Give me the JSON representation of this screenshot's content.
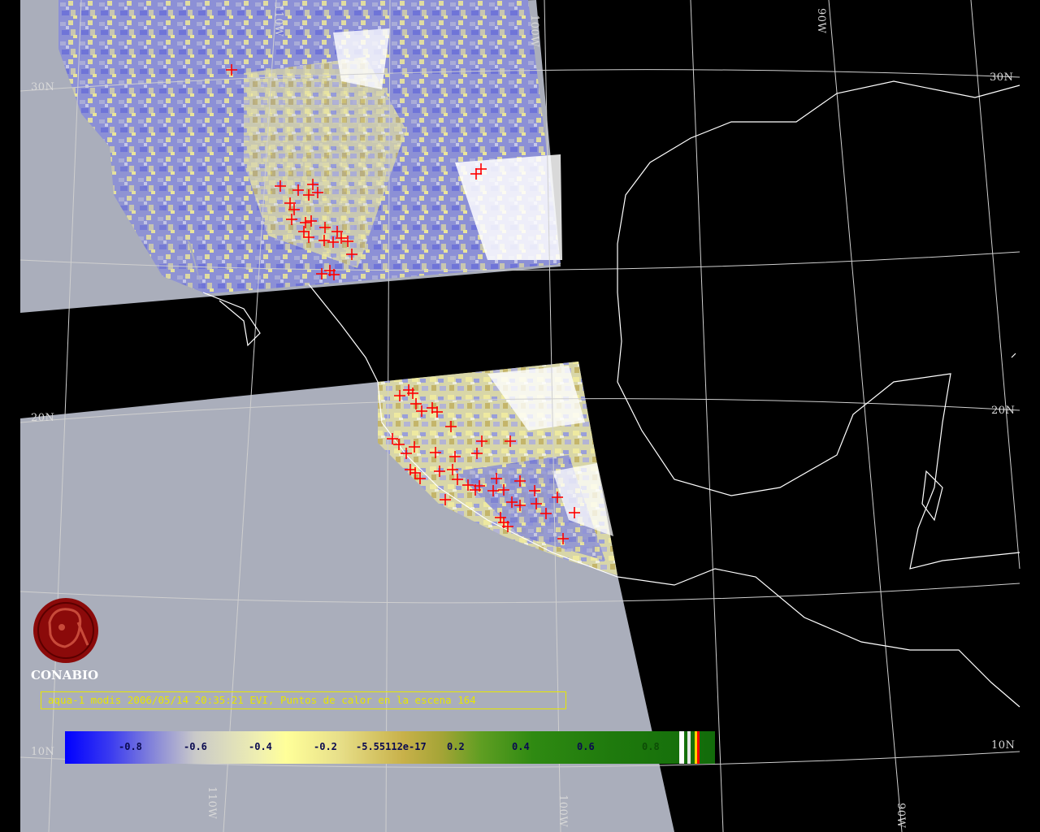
{
  "grid_labels": {
    "lat_30n_left": "30N",
    "lat_30n_right": "30N",
    "lat_20n_left": "20N",
    "lat_20n_right": "20N",
    "lat_10n_left": "10N",
    "lat_10n_right": "10N",
    "lon_110w_top": "110W",
    "lon_100w_top": "100W",
    "lon_90w_top": "90W",
    "lon_110w_bottom": "110W",
    "lon_100w_bottom": "100W",
    "lon_90w_bottom": "90W"
  },
  "logo": {
    "name": "CONABIO"
  },
  "caption": "aqua-1 modis 2006/05/14 20:35:21 EVI, Puntos de calor en la escena 164",
  "colorbar": {
    "ticks": [
      "-0.8",
      "-0.6",
      "-0.4",
      "-0.2",
      "-5.55112e-17",
      "0.2",
      "0.4",
      "0.6",
      "0.8"
    ],
    "range": [
      -1,
      1
    ]
  },
  "colors": {
    "background": "#000000",
    "outside_swath": "#aaaebb",
    "coastline": "#ffffff",
    "graticule": "#d0d0d0",
    "hotspot": "#ff0000",
    "caption": "#e6e600"
  }
}
